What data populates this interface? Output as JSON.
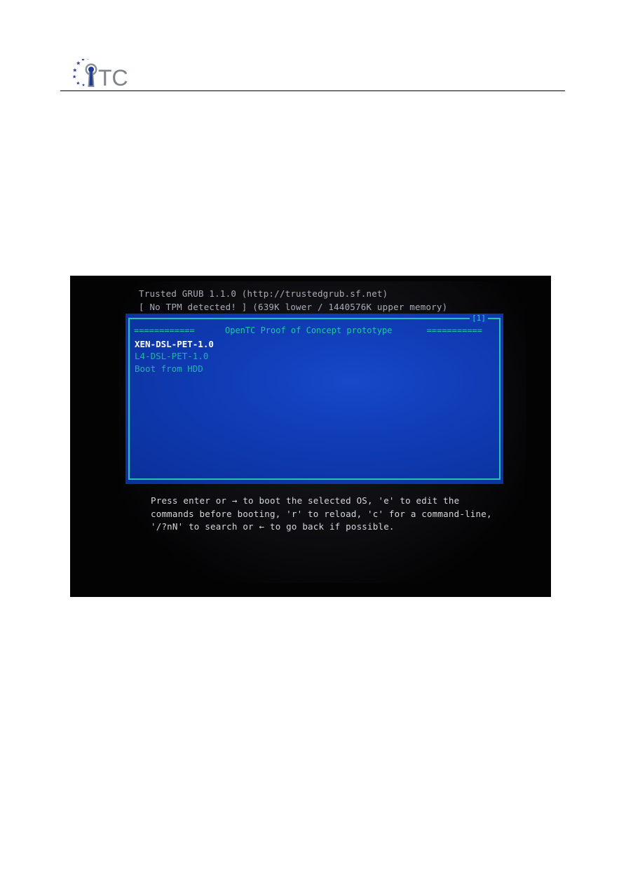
{
  "header": {
    "logo_text": "TC"
  },
  "screenshot": {
    "boot_header": [
      "Trusted GRUB 1.1.0 (http://trustedgrub.sf.net)",
      "[ No TPM detected! ] (639K lower / 1440576K upper memory)"
    ],
    "menu": {
      "title_dashes_left": "============",
      "title": "OpenTC Proof of Concept prototype",
      "title_dashes_right": "===========",
      "corner_marker": "[1]",
      "items": [
        {
          "label": "XEN-DSL-PET-1.0",
          "selected": true
        },
        {
          "label": "L4-DSL-PET-1.0",
          "selected": false
        },
        {
          "label": "Boot from HDD",
          "selected": false
        }
      ]
    },
    "help_lines": [
      "Press enter or → to boot the selected OS, 'e' to edit the",
      "commands before booting, 'r' to reload, 'c' for a command-line,",
      "'/?nN' to search or ← to go back if possible."
    ],
    "colors": {
      "menu_background": "#0f3bb4",
      "menu_border": "#29c0b4",
      "selected_item": "#ffffff",
      "unselected_item": "#1fb5a3",
      "terminal_background": "#030304"
    }
  }
}
